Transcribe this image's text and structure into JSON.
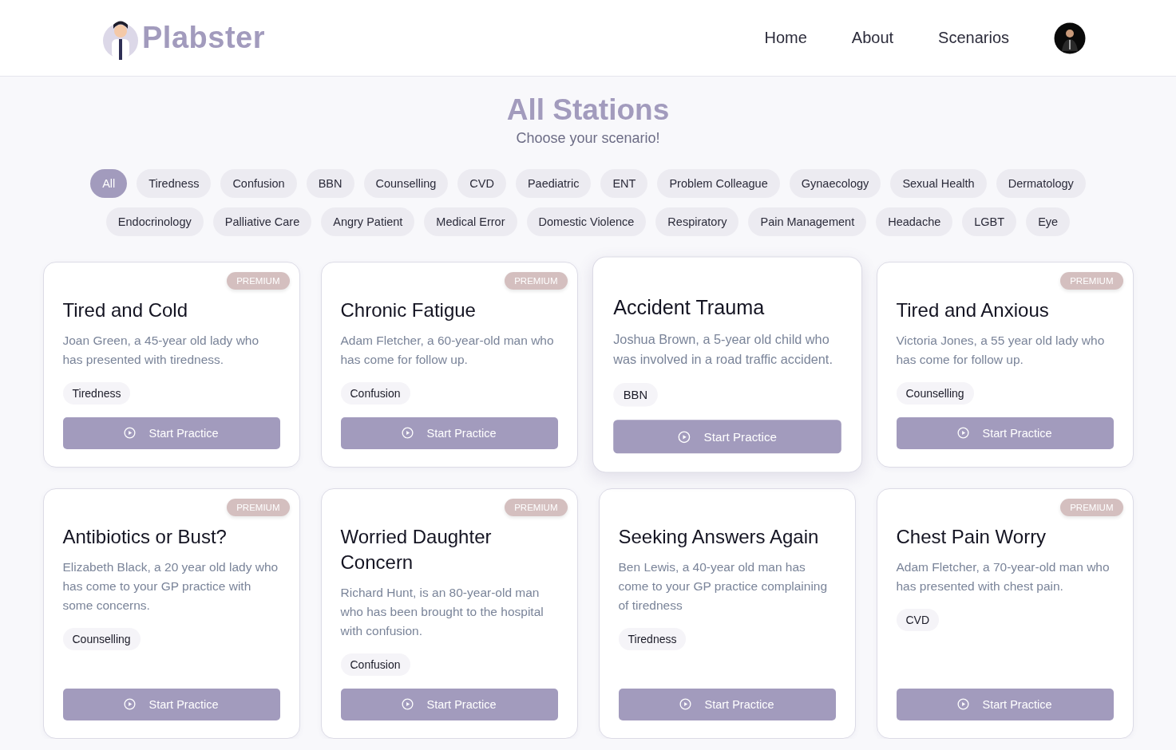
{
  "header": {
    "logo_text": "Plabster",
    "nav": [
      {
        "label": "Home"
      },
      {
        "label": "About"
      },
      {
        "label": "Scenarios"
      }
    ]
  },
  "heading": {
    "title": "All Stations",
    "subtitle": "Choose your scenario!"
  },
  "filters": [
    {
      "label": "All",
      "selected": true
    },
    {
      "label": "Tiredness",
      "selected": false
    },
    {
      "label": "Confusion",
      "selected": false
    },
    {
      "label": "BBN",
      "selected": false
    },
    {
      "label": "Counselling",
      "selected": false
    },
    {
      "label": "CVD",
      "selected": false
    },
    {
      "label": "Paediatric",
      "selected": false
    },
    {
      "label": "ENT",
      "selected": false
    },
    {
      "label": "Problem Colleague",
      "selected": false
    },
    {
      "label": "Gynaecology",
      "selected": false
    },
    {
      "label": "Sexual Health",
      "selected": false
    },
    {
      "label": "Dermatology",
      "selected": false
    },
    {
      "label": "Endocrinology",
      "selected": false
    },
    {
      "label": "Palliative Care",
      "selected": false
    },
    {
      "label": "Angry Patient",
      "selected": false
    },
    {
      "label": "Medical Error",
      "selected": false
    },
    {
      "label": "Domestic Violence",
      "selected": false
    },
    {
      "label": "Respiratory",
      "selected": false
    },
    {
      "label": "Pain Management",
      "selected": false
    },
    {
      "label": "Headache",
      "selected": false
    },
    {
      "label": "LGBT",
      "selected": false
    },
    {
      "label": "Eye",
      "selected": false
    }
  ],
  "stations": [
    {
      "title": "Tired and Cold",
      "description": "Joan Green, a 45-year old lady who has presented with tiredness.",
      "tag": "Tiredness",
      "premium": true,
      "premium_label": "PREMIUM",
      "hovered": false,
      "button": "Start Practice"
    },
    {
      "title": "Chronic Fatigue",
      "description": "Adam Fletcher, a 60-year-old man who has come for follow up.",
      "tag": "Confusion",
      "premium": true,
      "premium_label": "PREMIUM",
      "hovered": false,
      "button": "Start Practice"
    },
    {
      "title": "Accident Trauma",
      "description": "Joshua Brown, a 5-year old child who was involved in a road traffic accident.",
      "tag": "BBN",
      "premium": false,
      "hovered": true,
      "button": "Start Practice"
    },
    {
      "title": "Tired and Anxious",
      "description": "Victoria Jones, a 55 year old lady who has come for follow up.",
      "tag": "Counselling",
      "premium": true,
      "premium_label": "PREMIUM",
      "hovered": false,
      "button": "Start Practice"
    },
    {
      "title": "Antibiotics or Bust?",
      "description": "Elizabeth Black, a 20 year old lady who has come to your GP practice with some concerns.",
      "tag": "Counselling",
      "premium": true,
      "premium_label": "PREMIUM",
      "hovered": false,
      "button": "Start Practice"
    },
    {
      "title": "Worried Daughter Concern",
      "description": "Richard Hunt, is an 80-year-old man who has been brought to the hospital with confusion.",
      "tag": "Confusion",
      "premium": true,
      "premium_label": "PREMIUM",
      "hovered": false,
      "button": "Start Practice"
    },
    {
      "title": "Seeking Answers Again",
      "description": "Ben Lewis, a 40-year old man has come to your GP practice complaining of tiredness",
      "tag": "Tiredness",
      "premium": false,
      "hovered": false,
      "button": "Start Practice"
    },
    {
      "title": "Chest Pain Worry",
      "description": "Adam Fletcher, a 70-year-old man who has presented with chest pain.",
      "tag": "CVD",
      "premium": true,
      "premium_label": "PREMIUM",
      "hovered": false,
      "button": "Start Practice"
    }
  ]
}
